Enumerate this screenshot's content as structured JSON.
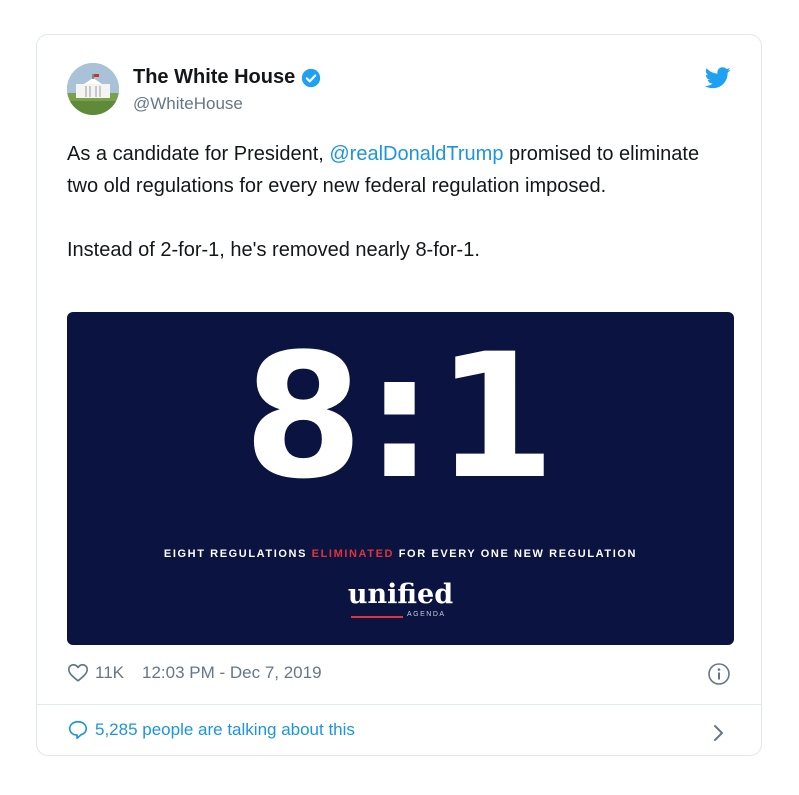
{
  "tweet": {
    "author_name": "The White House",
    "author_handle": "@WhiteHouse",
    "text_before_mention": "As a candidate for President, ",
    "mention": "@realDonaldTrump",
    "text_after_mention": " promised to eliminate two old regulations for every new federal regulation imposed.",
    "second_paragraph": "Instead of 2-for-1, he's removed nearly 8-for-1.",
    "likes": "11K",
    "timestamp": "12:03 PM - Dec 7, 2019",
    "talking": "5,285 people are talking about this"
  },
  "media": {
    "headline": "8:1",
    "tagline_start": "EIGHT REGULATIONS ",
    "tagline_highlight": "ELIMINATED",
    "tagline_end": " FOR EVERY ONE NEW REGULATION",
    "logo_word": "unified",
    "logo_sub": "AGENDA",
    "background_color": "#0b1340",
    "highlight_color": "#e0333b"
  },
  "colors": {
    "link": "#1b95e0",
    "muted": "#657786",
    "verified": "#1da1f2"
  },
  "icons": {
    "verified": "verified-badge-icon",
    "bird": "twitter-bird-icon",
    "heart": "heart-icon",
    "info": "info-icon",
    "bubble": "speech-bubble-icon",
    "chevron": "chevron-right-icon"
  }
}
